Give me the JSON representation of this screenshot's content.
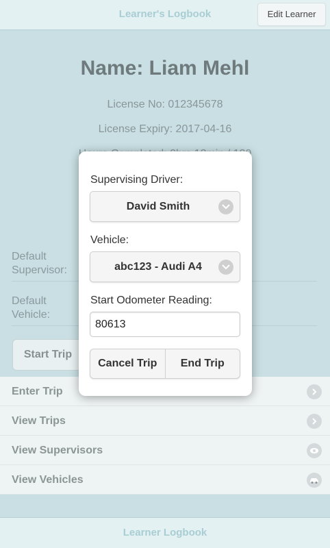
{
  "header": {
    "title": "Learner's Logbook",
    "edit_label": "Edit Learner"
  },
  "learner": {
    "name": "Name: Liam Mehl",
    "license_no": "License No: 012345678",
    "license_expiry": "License Expiry: 2017-04-16",
    "hours": "Hours Completed: 0hrs 12min / 120"
  },
  "defaults": {
    "supervisor_label": "Default\nSupervisor:",
    "vehicle_label": "Default\nVehicle:"
  },
  "start_trip_label": "Start Trip",
  "menu": [
    {
      "label": "Enter Trip",
      "icon": "chevron-right-icon"
    },
    {
      "label": "View Trips",
      "icon": "chevron-right-icon"
    },
    {
      "label": "View Supervisors",
      "icon": "eye-icon"
    },
    {
      "label": "View Vehicles",
      "icon": "car-icon"
    }
  ],
  "popup": {
    "supervisor_label": "Supervising Driver:",
    "supervisor_value": "David Smith",
    "vehicle_label": "Vehicle:",
    "vehicle_value": "abc123 - Audi A4",
    "odometer_label": "Start Odometer Reading:",
    "odometer_value": "80613",
    "cancel_label": "Cancel Trip",
    "end_label": "End Trip"
  },
  "footer": {
    "title": "Learner Logbook"
  }
}
